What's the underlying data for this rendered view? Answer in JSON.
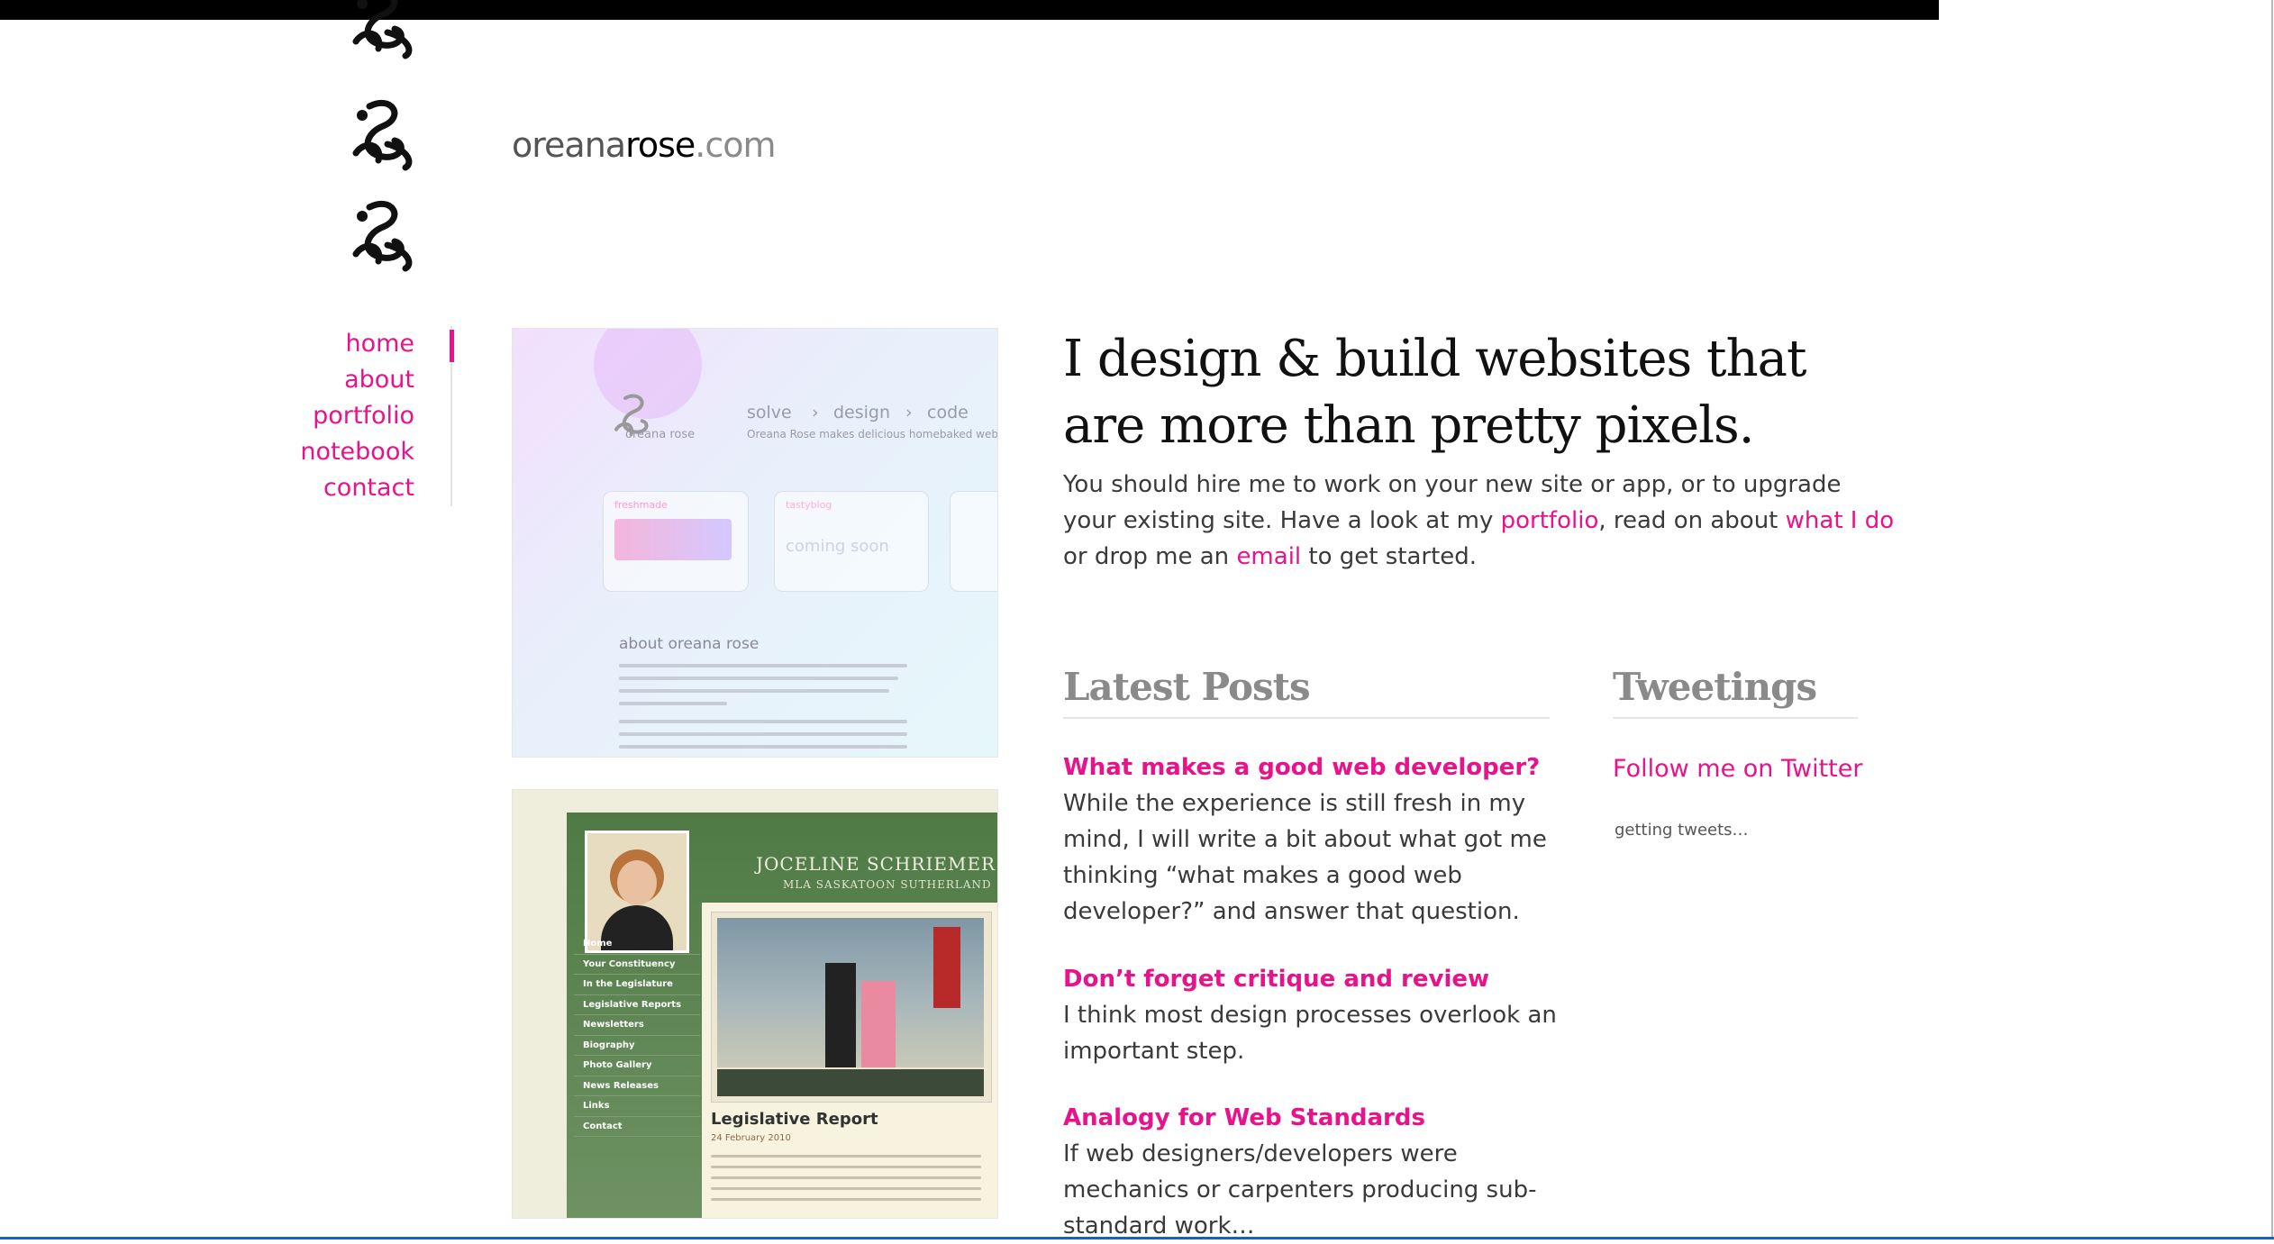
{
  "brand": {
    "logo_part1": "oreana",
    "logo_part2": "rose",
    "logo_part3": ".com"
  },
  "nav": {
    "items": [
      {
        "label": "home",
        "active": true
      },
      {
        "label": "about"
      },
      {
        "label": "portfolio"
      },
      {
        "label": "notebook"
      },
      {
        "label": "contact"
      }
    ]
  },
  "hero": {
    "headline": "I design & build websites that are more than pretty pixels.",
    "intro_before": "You should hire me to work on your new site or app, or to upgrade your existing site. Have a look at my ",
    "link_portfolio": "portfolio",
    "intro_mid1": ", read on about ",
    "link_whatido": "what I do",
    "intro_mid2": " or drop me an ",
    "link_email": "email",
    "intro_after": " to get started."
  },
  "portfolio": {
    "shot1": {
      "nav": [
        "solve",
        "design",
        "code"
      ],
      "brand": "oreana rose",
      "tagline": "Oreana Rose makes delicious homebaked websites",
      "about_heading": "about oreana rose",
      "card_labels": [
        "freshmade",
        "tastyblog",
        "coming soon"
      ]
    },
    "shot2": {
      "name": "JOCELINE SCHRIEMER",
      "subtitle": "MLA SASKATOON SUTHERLAND",
      "menu": [
        "Home",
        "Your Constituency",
        "In the Legislature",
        "Legislative Reports",
        "Newsletters",
        "Biography",
        "Photo Gallery",
        "News Releases",
        "Links",
        "Contact"
      ],
      "article_title": "Legislative Report",
      "article_date": "24 February 2010"
    }
  },
  "latest_posts": {
    "title": "Latest Posts",
    "posts": [
      {
        "title": "What makes a good web developer?",
        "excerpt": "While the experience is still fresh in my mind, I will write a bit about what got me thinking “what makes a good web developer?” and answer that question."
      },
      {
        "title": "Don’t forget critique and review",
        "excerpt": "I think most design processes overlook an important step."
      },
      {
        "title": "Analogy for Web Standards",
        "excerpt": "If web designers/developers were mechanics or carpenters producing sub-standard work…"
      }
    ]
  },
  "tweetings": {
    "title": "Tweetings",
    "follow_label": "Follow me on Twitter",
    "status": "getting tweets…"
  },
  "colors": {
    "accent": "#e8138b",
    "text": "#3a3a3a",
    "heading_muted": "#8a8a8a"
  },
  "icons": [
    "rose-ornament-icon"
  ]
}
